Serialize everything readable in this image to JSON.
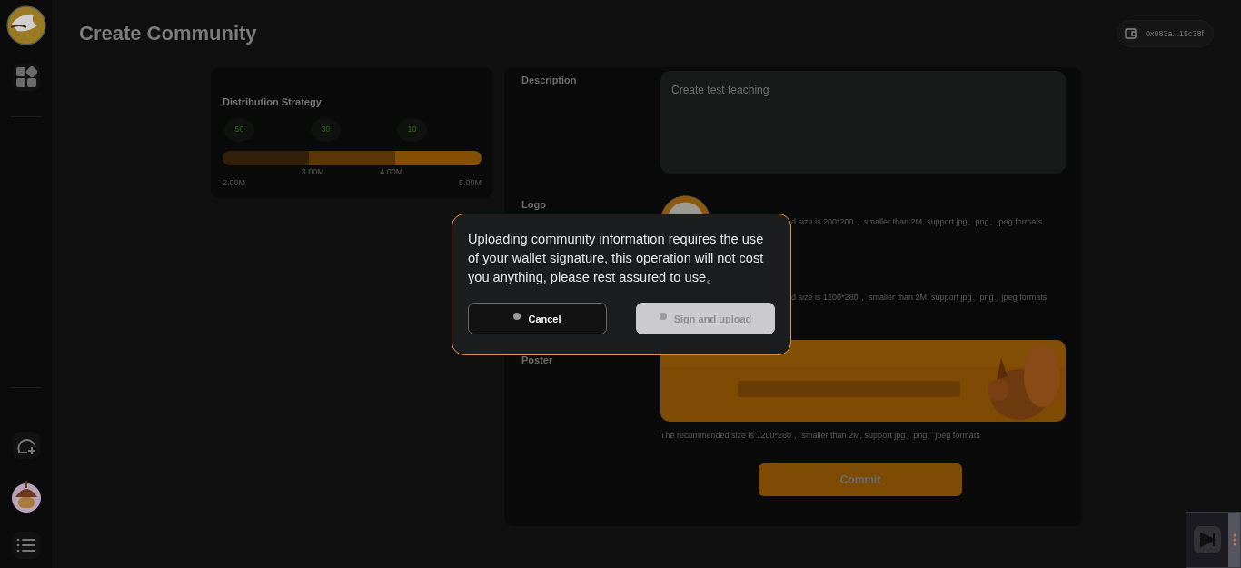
{
  "header": {
    "title": "Create Community",
    "wallet": "0x083a...15c38f"
  },
  "distribution": {
    "title": "Distribution Strategy",
    "segments": [
      {
        "value": "50",
        "color": "#33200b"
      },
      {
        "value": "30",
        "color": "#5a3505"
      },
      {
        "value": "10",
        "color": "#854f03"
      }
    ],
    "start": "2.00M",
    "ticks": [
      "3.00M",
      "4.00M"
    ],
    "end": "5.00M"
  },
  "form": {
    "description_label": "Description",
    "description": "Create test teaching",
    "logo_label": "Logo",
    "logo_hint": "d size is 200*200， smaller than 2M, support jpg、png、jpeg formats",
    "cover_hint": "d size is 1200*280， smaller than 2M, support jpg、png、jpeg formats",
    "poster_label": "Poster",
    "poster_hint": "The recommended size is 1200*280， smaller than 2M, support jpg、png、jpeg formats",
    "commit": "Commit"
  },
  "modal": {
    "message": "Uploading community information requires the use of your wallet signature, this operation will not cost you anything, please rest assured to use。",
    "buttons": [
      {
        "label": "Cancel",
        "kind": "secondary"
      },
      {
        "label": "Sign and upload",
        "kind": "primary"
      }
    ]
  }
}
